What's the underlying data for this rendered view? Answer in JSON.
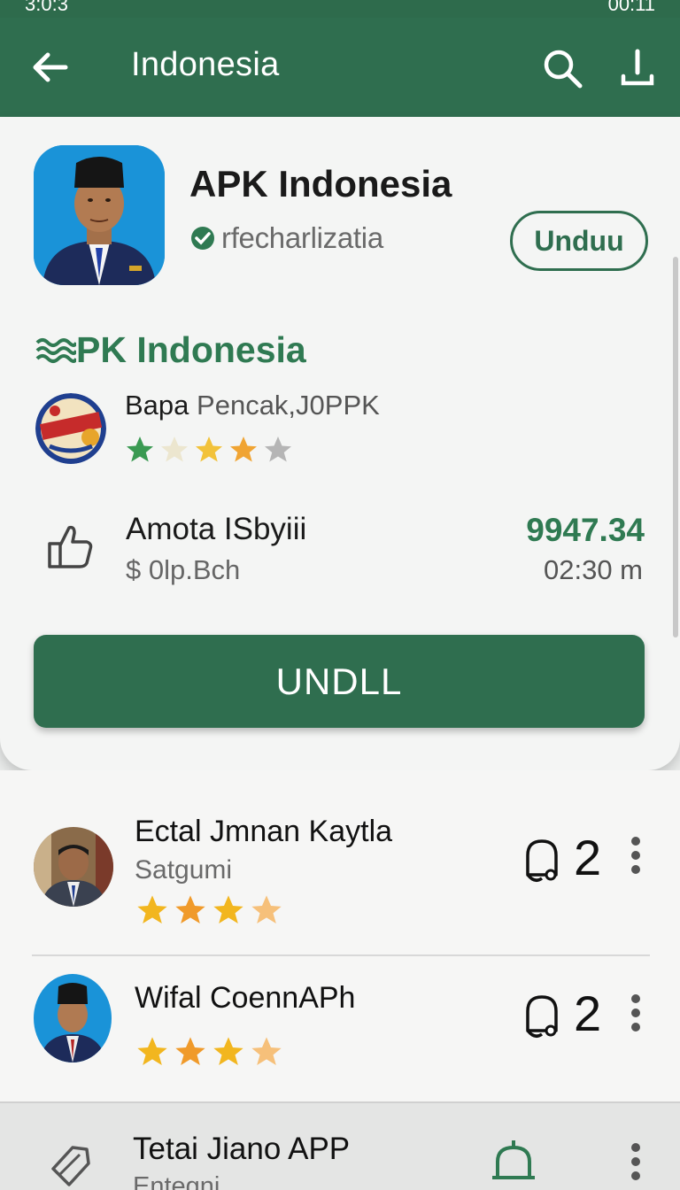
{
  "status_bar": {
    "time": "3:0:3",
    "right": "00:11"
  },
  "app_bar": {
    "title": "Indonesia"
  },
  "app": {
    "name": "APK Indonesia",
    "publisher": "rfecharlizatia",
    "install_label": "Unduu"
  },
  "section": {
    "title": "PK Indonesia",
    "developer_primary": "Bapa",
    "developer_secondary": "Pencak,J0PPK",
    "rating_stars": 5
  },
  "info": {
    "title": "Amota ISbyiii",
    "subtitle": "$ 0lp.Bch",
    "value": "9947.34",
    "time": "02:30 m"
  },
  "primary_button": {
    "label": "UNDLL"
  },
  "list": [
    {
      "title": "Ectal Jmnan Kaytla",
      "subtitle": "Satgumi",
      "count": "2",
      "stars": 4
    },
    {
      "title": "Wifal CoennAPh",
      "subtitle": "",
      "count": "2",
      "stars": 4
    }
  ],
  "bottom_item": {
    "title": "Tetai Jiano APP",
    "subtitle": "Entegni"
  },
  "colors": {
    "primary": "#2f6e4f",
    "accent_text": "#2f7a52",
    "star": "#f2b61f"
  }
}
